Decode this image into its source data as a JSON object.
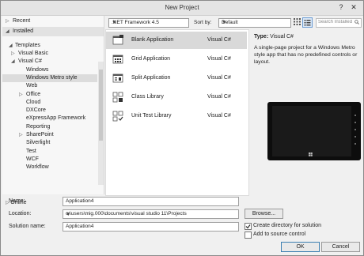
{
  "window": {
    "title": "New Project",
    "help": "?",
    "close": "✕"
  },
  "tree": {
    "recent": "Recent",
    "installed": "Installed",
    "templates": "Templates",
    "items": [
      {
        "label": "Visual Basic",
        "arrow": "▷"
      },
      {
        "label": "Visual C#",
        "arrow": "◢"
      },
      {
        "label": "Windows",
        "arrow": ""
      },
      {
        "label": "Windows Metro style",
        "arrow": ""
      },
      {
        "label": "Web",
        "arrow": ""
      },
      {
        "label": "Office",
        "arrow": "▷"
      },
      {
        "label": "Cloud",
        "arrow": ""
      },
      {
        "label": "DXCore",
        "arrow": ""
      },
      {
        "label": "eXpressApp Framework",
        "arrow": ""
      },
      {
        "label": "Reporting",
        "arrow": ""
      },
      {
        "label": "SharePoint",
        "arrow": "▷"
      },
      {
        "label": "Silverlight",
        "arrow": ""
      },
      {
        "label": "Test",
        "arrow": ""
      },
      {
        "label": "WCF",
        "arrow": ""
      },
      {
        "label": "Workflow",
        "arrow": ""
      }
    ],
    "online": "Online"
  },
  "toolbar": {
    "framework": ".NET Framework 4.5",
    "sort_label": "Sort by:",
    "sort_value": "Default",
    "search_placeholder": "Search Installed Te"
  },
  "templates": [
    {
      "name": "Blank Application",
      "lang": "Visual C#",
      "selected": true
    },
    {
      "name": "Grid Application",
      "lang": "Visual C#"
    },
    {
      "name": "Split Application",
      "lang": "Visual C#"
    },
    {
      "name": "Class Library",
      "lang": "Visual C#"
    },
    {
      "name": "Unit Test Library",
      "lang": "Visual C#"
    }
  ],
  "description": {
    "type_label": "Type:",
    "type_value": "Visual C#",
    "text": "A single-page project for a Windows Metro style app that has no predefined controls or layout."
  },
  "form": {
    "name_label": "Name:",
    "name_value": "Application4",
    "location_label": "Location:",
    "location_value": "c:\\users\\mig.000\\documents\\visual studio 11\\Projects",
    "browse": "Browse...",
    "solution_label": "Solution name:",
    "solution_value": "Application4",
    "create_dir": "Create directory for solution",
    "create_dir_checked": true,
    "add_source": "Add to source control",
    "add_source_checked": false,
    "ok": "OK",
    "cancel": "Cancel"
  }
}
